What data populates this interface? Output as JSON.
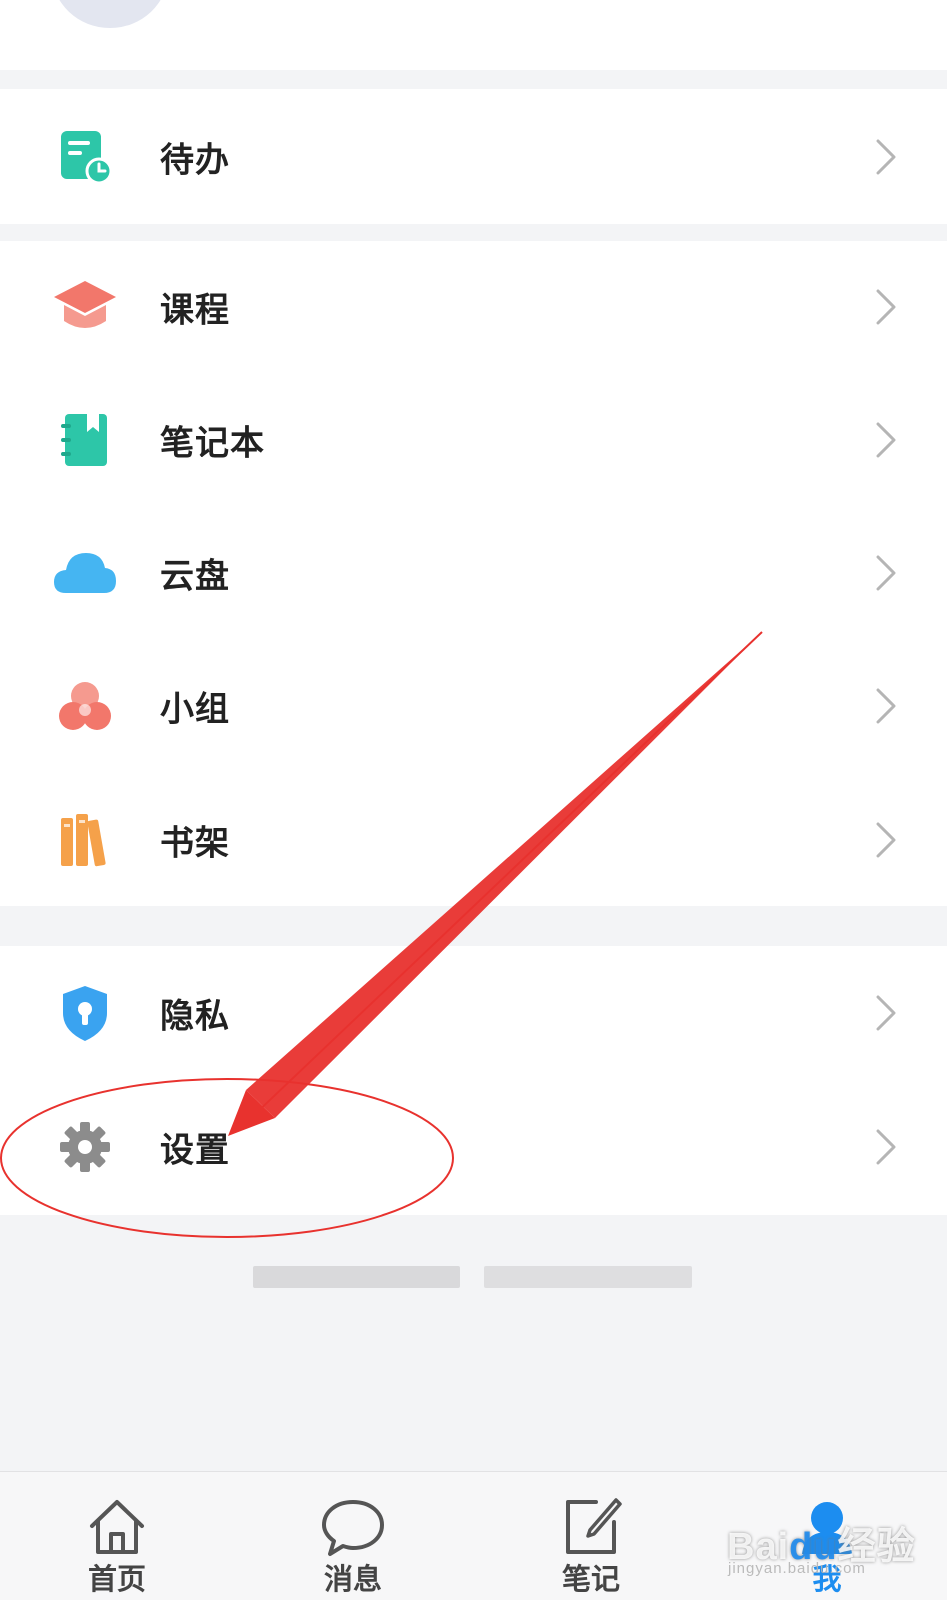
{
  "menu": {
    "group1": [
      {
        "id": "todo",
        "label": "待办",
        "icon": "todo-clock-icon",
        "color": "#2dc6a8"
      }
    ],
    "group2": [
      {
        "id": "course",
        "label": "课程",
        "icon": "graduation-cap-icon",
        "color": "#f2776b"
      },
      {
        "id": "notebook",
        "label": "笔记本",
        "icon": "notebook-icon",
        "color": "#2dc6a8"
      },
      {
        "id": "cloud",
        "label": "云盘",
        "icon": "cloud-icon",
        "color": "#45b5f2"
      },
      {
        "id": "group",
        "label": "小组",
        "icon": "group-circles-icon",
        "color": "#f2776b"
      },
      {
        "id": "bookshelf",
        "label": "书架",
        "icon": "bookshelf-icon",
        "color": "#f5a14a"
      }
    ],
    "group3": [
      {
        "id": "privacy",
        "label": "隐私",
        "icon": "shield-lock-icon",
        "color": "#3aa3f0"
      },
      {
        "id": "settings",
        "label": "设置",
        "icon": "gear-icon",
        "color": "#8c8c8c"
      }
    ]
  },
  "bottom_nav": {
    "items": [
      {
        "label": "首页",
        "icon": "home-icon",
        "active": false
      },
      {
        "label": "消息",
        "icon": "chat-bubble-icon",
        "active": false
      },
      {
        "label": "笔记",
        "icon": "note-edit-icon",
        "active": false
      },
      {
        "label": "我",
        "icon": "profile-icon",
        "active": true
      }
    ]
  },
  "colors": {
    "accent": "#1c8df0",
    "annotation": "#e8322e"
  },
  "watermark": {
    "brand": "Bai",
    "brand_suffix": "经验",
    "url": "jingyan.baidu.com"
  }
}
